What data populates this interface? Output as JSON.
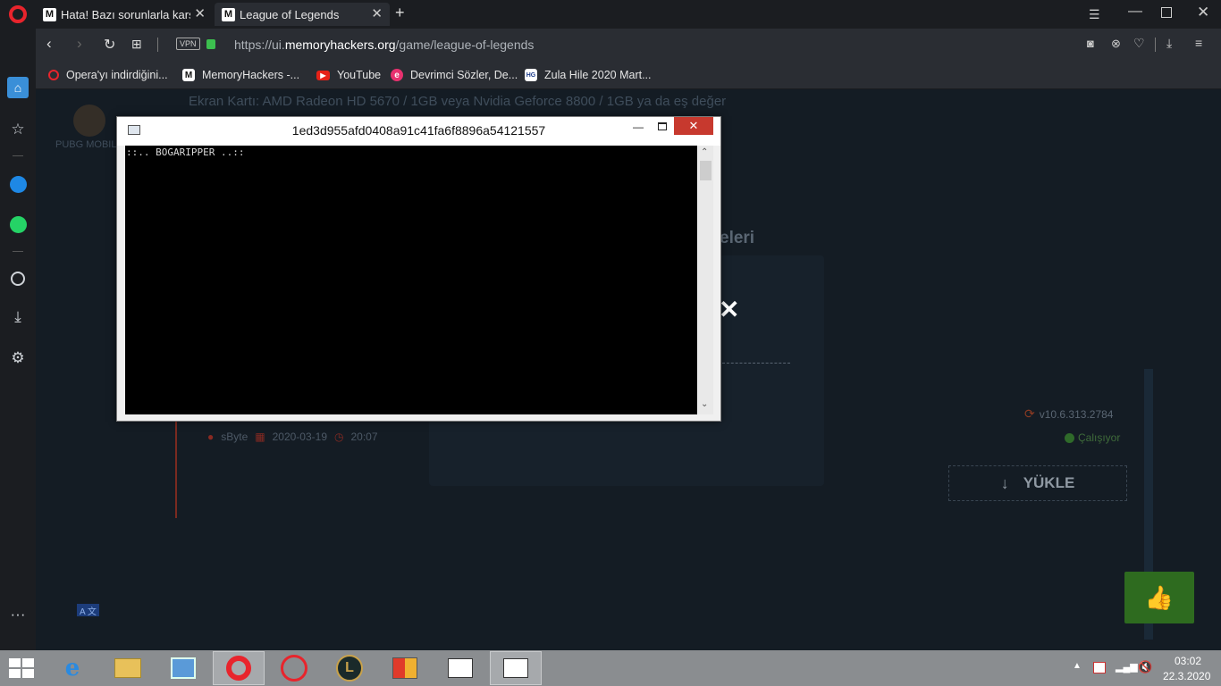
{
  "browser": {
    "tabs": [
      {
        "label": "Hata! Bazı sorunlarla karşıla",
        "icon": "memoryhackers-icon"
      },
      {
        "label": "League of Legends",
        "icon": "memoryhackers-icon"
      }
    ],
    "new_tab_label": "+",
    "address": {
      "vpn_label": "VPN",
      "url_prefix": "https://ui.",
      "url_host": "memoryhackers.org",
      "url_path": "/game/league-of-legends"
    },
    "bookmarks": [
      {
        "label": "Opera'yı indirdiğini...",
        "icon": "opera-icon"
      },
      {
        "label": "MemoryHackers -...",
        "icon": "memoryhackers-icon"
      },
      {
        "label": "YouTube",
        "icon": "youtube-icon"
      },
      {
        "label": "Devrimci Sözler, De...",
        "icon": "devrimci-icon"
      },
      {
        "label": "Zula Hile 2020 Mart...",
        "icon": "zula-icon"
      }
    ]
  },
  "page": {
    "requirements_line": "Ekran Kartı: AMD Radeon HD 5670 / 1GB veya Nvidia Geforce 8800 / 1GB ya da eş değer",
    "sidebar_game_label": "PUBG MOBIL",
    "section_heading_fragment": "eleri",
    "author": "sByte",
    "date": "2020-03-19",
    "time": "20:07",
    "version": "v10.6.313.2784",
    "status": "Çalışıyor",
    "download_label": "YÜKLE",
    "lang_badge": "A 文"
  },
  "console": {
    "title": "1ed3d955afd0408a91c41fa6f8896a54121557",
    "output": "::.. BOGARIPPER ..::"
  },
  "taskbar": {
    "clock_time": "03:02",
    "clock_date": "22.3.2020"
  },
  "colors": {
    "accent_red": "#e0302a",
    "green_like": "#3aa52a",
    "opera_red": "#ff1b2d"
  }
}
